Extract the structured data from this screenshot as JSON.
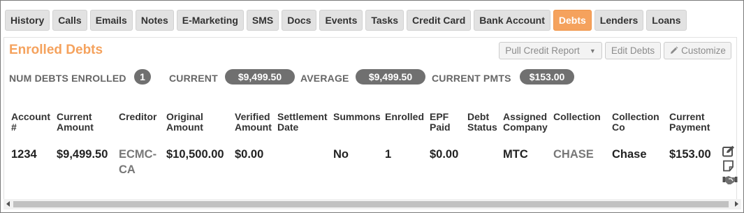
{
  "tabs": [
    {
      "label": "History"
    },
    {
      "label": "Calls"
    },
    {
      "label": "Emails"
    },
    {
      "label": "Notes"
    },
    {
      "label": "E-Marketing"
    },
    {
      "label": "SMS"
    },
    {
      "label": "Docs"
    },
    {
      "label": "Events"
    },
    {
      "label": "Tasks"
    },
    {
      "label": "Credit Card"
    },
    {
      "label": "Bank Account"
    },
    {
      "label": "Debts",
      "active": true
    },
    {
      "label": "Lenders"
    },
    {
      "label": "Loans"
    }
  ],
  "panel": {
    "title": "Enrolled Debts",
    "buttons": {
      "pull_credit": "Pull Credit Report",
      "edit_debts": "Edit Debts",
      "customize": "Customize"
    }
  },
  "stats": {
    "num_enrolled_label": "NUM DEBTS ENROLLED",
    "num_enrolled_value": "1",
    "current_label": "CURRENT",
    "current_value": "$9,499.50",
    "average_label": "AVERAGE",
    "average_value": "$9,499.50",
    "current_pmts_label": "CURRENT PMTS",
    "current_pmts_value": "$153.00"
  },
  "table": {
    "headers": {
      "account": "Account #",
      "current_amount": "Current Amount",
      "creditor": "Creditor",
      "original_amount": "Original Amount",
      "verified_amount": "Verified Amount",
      "settlement_date": "Settlement Date",
      "summons": "Summons",
      "enrolled": "Enrolled",
      "epf_paid": "EPF Paid",
      "debt_status": "Debt Status",
      "assigned_company": "Assigned Company",
      "collection": "Collection",
      "collection_co": "Collection Co",
      "current_payment": "Current Payment"
    },
    "row": {
      "account": "1234",
      "current_amount": "$9,499.50",
      "creditor": "ECMC-CA",
      "original_amount": "$10,500.00",
      "verified_amount": "$0.00",
      "settlement_date": "",
      "summons": "No",
      "enrolled": "1",
      "epf_paid": "$0.00",
      "debt_status": "",
      "assigned_company": "MTC",
      "collection": "CHASE",
      "collection_co": "Chase",
      "current_payment": "$153.00"
    }
  },
  "colors": {
    "accent": "#f5a25d",
    "badge": "#707070",
    "tab_bg": "#e2e2e2"
  },
  "icons": {
    "customize": "pencil-icon",
    "row_edit": "edit-icon",
    "row_note": "note-icon",
    "row_handshake": "handshake-icon"
  }
}
